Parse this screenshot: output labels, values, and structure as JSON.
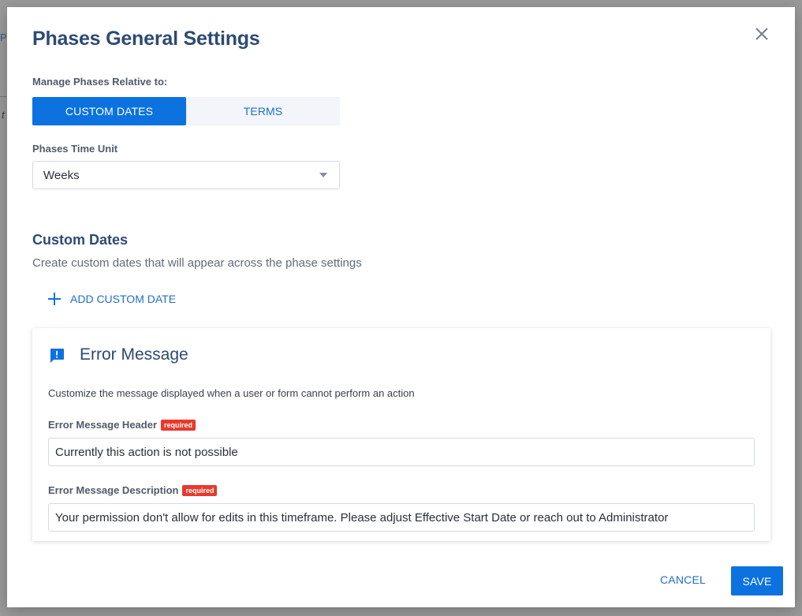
{
  "background": {
    "fragment_top": "PH",
    "fragment_italic": "t"
  },
  "modal": {
    "title": "Phases General Settings",
    "close_icon": "close-icon"
  },
  "relative_to": {
    "label": "Manage Phases Relative to:",
    "options": [
      {
        "label": "CUSTOM DATES",
        "selected": true
      },
      {
        "label": "TERMS",
        "selected": false
      }
    ]
  },
  "time_unit": {
    "label": "Phases Time Unit",
    "value": "Weeks"
  },
  "custom_dates": {
    "title": "Custom Dates",
    "description": "Create custom dates that will appear across the phase settings",
    "add_label": "ADD CUSTOM DATE"
  },
  "error_message": {
    "icon": "feedback-icon",
    "title": "Error Message",
    "description": "Customize the message displayed when a user or form cannot perform an action",
    "header_label": "Error Message Header",
    "header_value": "Currently this action is not possible",
    "description_label": "Error Message Description",
    "description_value": "Your permission don't allow for edits in this timeframe. Please adjust Effective Start Date or reach out to Administrator",
    "required_badge": "required"
  },
  "footer": {
    "cancel_label": "CANCEL",
    "save_label": "SAVE"
  },
  "colors": {
    "primary": "#0b72e0",
    "heading": "#2d4a74",
    "required": "#e8392b"
  }
}
